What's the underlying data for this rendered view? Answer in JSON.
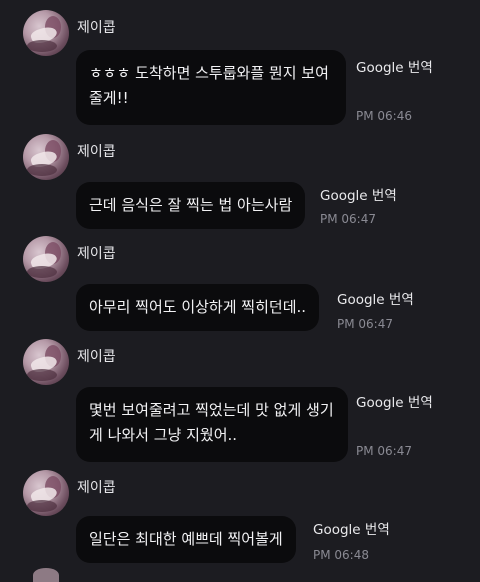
{
  "messages": [
    {
      "sender": "제이콥",
      "text": "ㅎㅎㅎ 도착하면 스투룹와플 뭔지 보여줄게!!",
      "translate_label": "Google 번역",
      "time": "PM 06:46"
    },
    {
      "sender": "제이콥",
      "text": "근데 음식은 잘 찍는 법 아는사람",
      "translate_label": "Google 번역",
      "time": "PM 06:47"
    },
    {
      "sender": "제이콥",
      "text": "아무리 찍어도 이상하게 찍히던데..",
      "translate_label": "Google 번역",
      "time": "PM 06:47"
    },
    {
      "sender": "제이콥",
      "text": "몇번 보여줄려고 찍었는데 맛 없게 생기게 나와서 그냥 지웠어..",
      "translate_label": "Google 번역",
      "time": "PM 06:47"
    },
    {
      "sender": "제이콥",
      "text": "일단은 최대한 예쁘데 찍어볼게",
      "translate_label": "Google 번역",
      "time": "PM 06:48"
    }
  ]
}
